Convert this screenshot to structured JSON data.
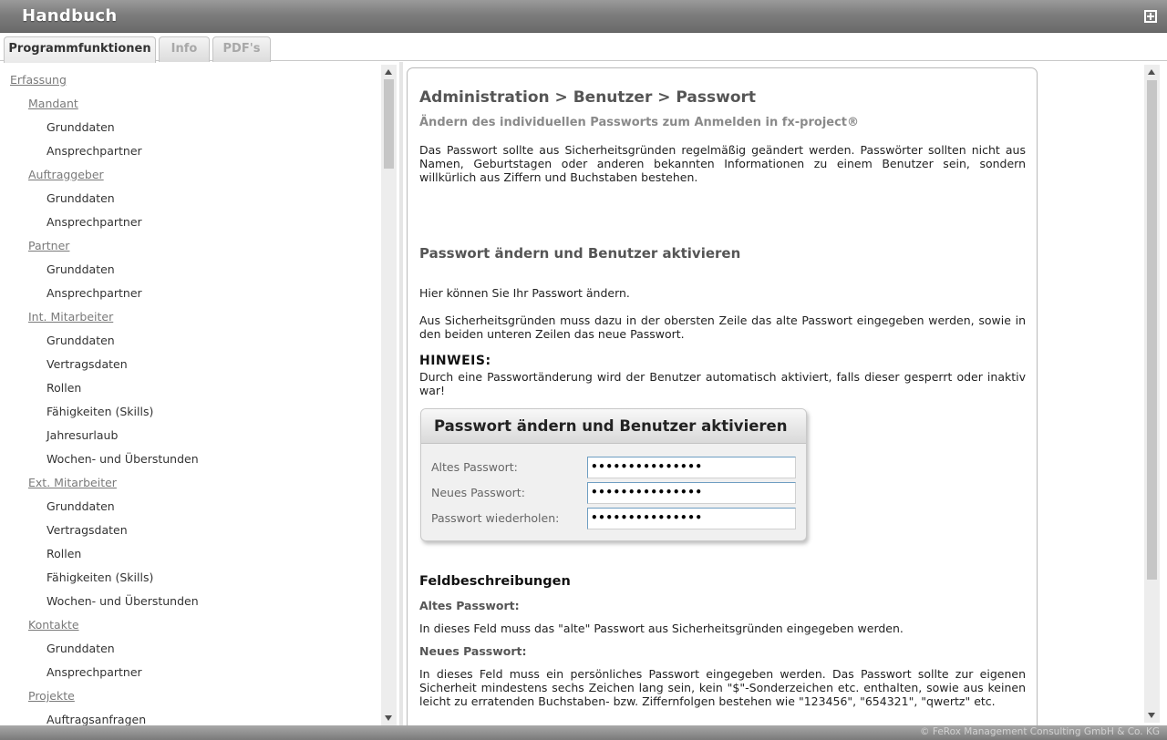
{
  "window": {
    "title": "Handbuch"
  },
  "tabs": [
    "Programmfunktionen",
    "Info",
    "PDF's"
  ],
  "nav": [
    {
      "label": "Erfassung",
      "level": 0
    },
    {
      "label": "Mandant",
      "level": 1
    },
    {
      "label": "Grunddaten",
      "level": 2
    },
    {
      "label": "Ansprechpartner",
      "level": 2
    },
    {
      "label": "Auftraggeber",
      "level": 1
    },
    {
      "label": "Grunddaten",
      "level": 2
    },
    {
      "label": "Ansprechpartner",
      "level": 2
    },
    {
      "label": "Partner",
      "level": 1
    },
    {
      "label": "Grunddaten",
      "level": 2
    },
    {
      "label": "Ansprechpartner",
      "level": 2
    },
    {
      "label": "Int. Mitarbeiter",
      "level": 1
    },
    {
      "label": "Grunddaten",
      "level": 2
    },
    {
      "label": "Vertragsdaten",
      "level": 2
    },
    {
      "label": "Rollen",
      "level": 2
    },
    {
      "label": "Fähigkeiten (Skills)",
      "level": 2
    },
    {
      "label": "Jahresurlaub",
      "level": 2
    },
    {
      "label": "Wochen- und Überstunden",
      "level": 2
    },
    {
      "label": "Ext. Mitarbeiter",
      "level": 1
    },
    {
      "label": "Grunddaten",
      "level": 2
    },
    {
      "label": "Vertragsdaten",
      "level": 2
    },
    {
      "label": "Rollen",
      "level": 2
    },
    {
      "label": "Fähigkeiten (Skills)",
      "level": 2
    },
    {
      "label": "Wochen- und Überstunden",
      "level": 2
    },
    {
      "label": "Kontakte",
      "level": 1
    },
    {
      "label": "Grunddaten",
      "level": 2
    },
    {
      "label": "Ansprechpartner",
      "level": 2
    },
    {
      "label": "Projekte",
      "level": 1
    },
    {
      "label": "Auftragsanfragen",
      "level": 2
    }
  ],
  "article": {
    "heading": "Administration > Benutzer > Passwort",
    "subheading": "Ändern des individuellen Passworts zum Anmelden in fx-project®",
    "intro": "Das Passwort sollte aus Sicherheitsgründen regelmäßig geändert werden. Passwörter sollten nicht aus Namen, Geburtstagen oder anderen bekannten Informationen zu einem Benutzer sein, sondern willkürlich aus Ziffern und Buchstaben bestehen.",
    "section_title": "Passwort ändern und Benutzer aktivieren",
    "p1": "Hier können Sie Ihr Passwort ändern.",
    "p2": "Aus Sicherheitsgründen muss dazu in der obersten Zeile das alte Passwort eingegeben werden, sowie in den beiden unteren Zeilen das neue Passwort.",
    "note_title": "HINWEIS:",
    "note_text": "Durch eine Passwortänderung wird der Benutzer automatisch aktiviert, falls dieser gesperrt oder inaktiv war!",
    "dialog": {
      "title": "Passwort ändern und Benutzer aktivieren",
      "fields": [
        {
          "label": "Altes Passwort:",
          "value": "•••••••••••••••"
        },
        {
          "label": "Neues Passwort:",
          "value": "•••••••••••••••"
        },
        {
          "label": "Passwort wiederholen:",
          "value": "•••••••••••••••"
        }
      ]
    },
    "fields_title": "Feldbeschreibungen",
    "field1_label": "Altes Passwort:",
    "field1_text": "In dieses Feld muss das \"alte\" Passwort aus Sicherheitsgründen eingegeben werden.",
    "field2_label": "Neues Passwort:",
    "field2_text": "In dieses Feld muss ein persönliches Passwort eingegeben werden. Das Passwort sollte zur eigenen Sicherheit mindestens sechs Zeichen lang sein, kein \"$\"-Sonderzeichen etc. enthalten, sowie aus keinen leicht zu erratenden Buchstaben- bzw. Ziffernfolgen bestehen wie \"123456\", \"654321\", \"qwertz\" etc."
  },
  "status": {
    "copyright": "© FeRox Management Consulting GmbH & Co. KG"
  }
}
